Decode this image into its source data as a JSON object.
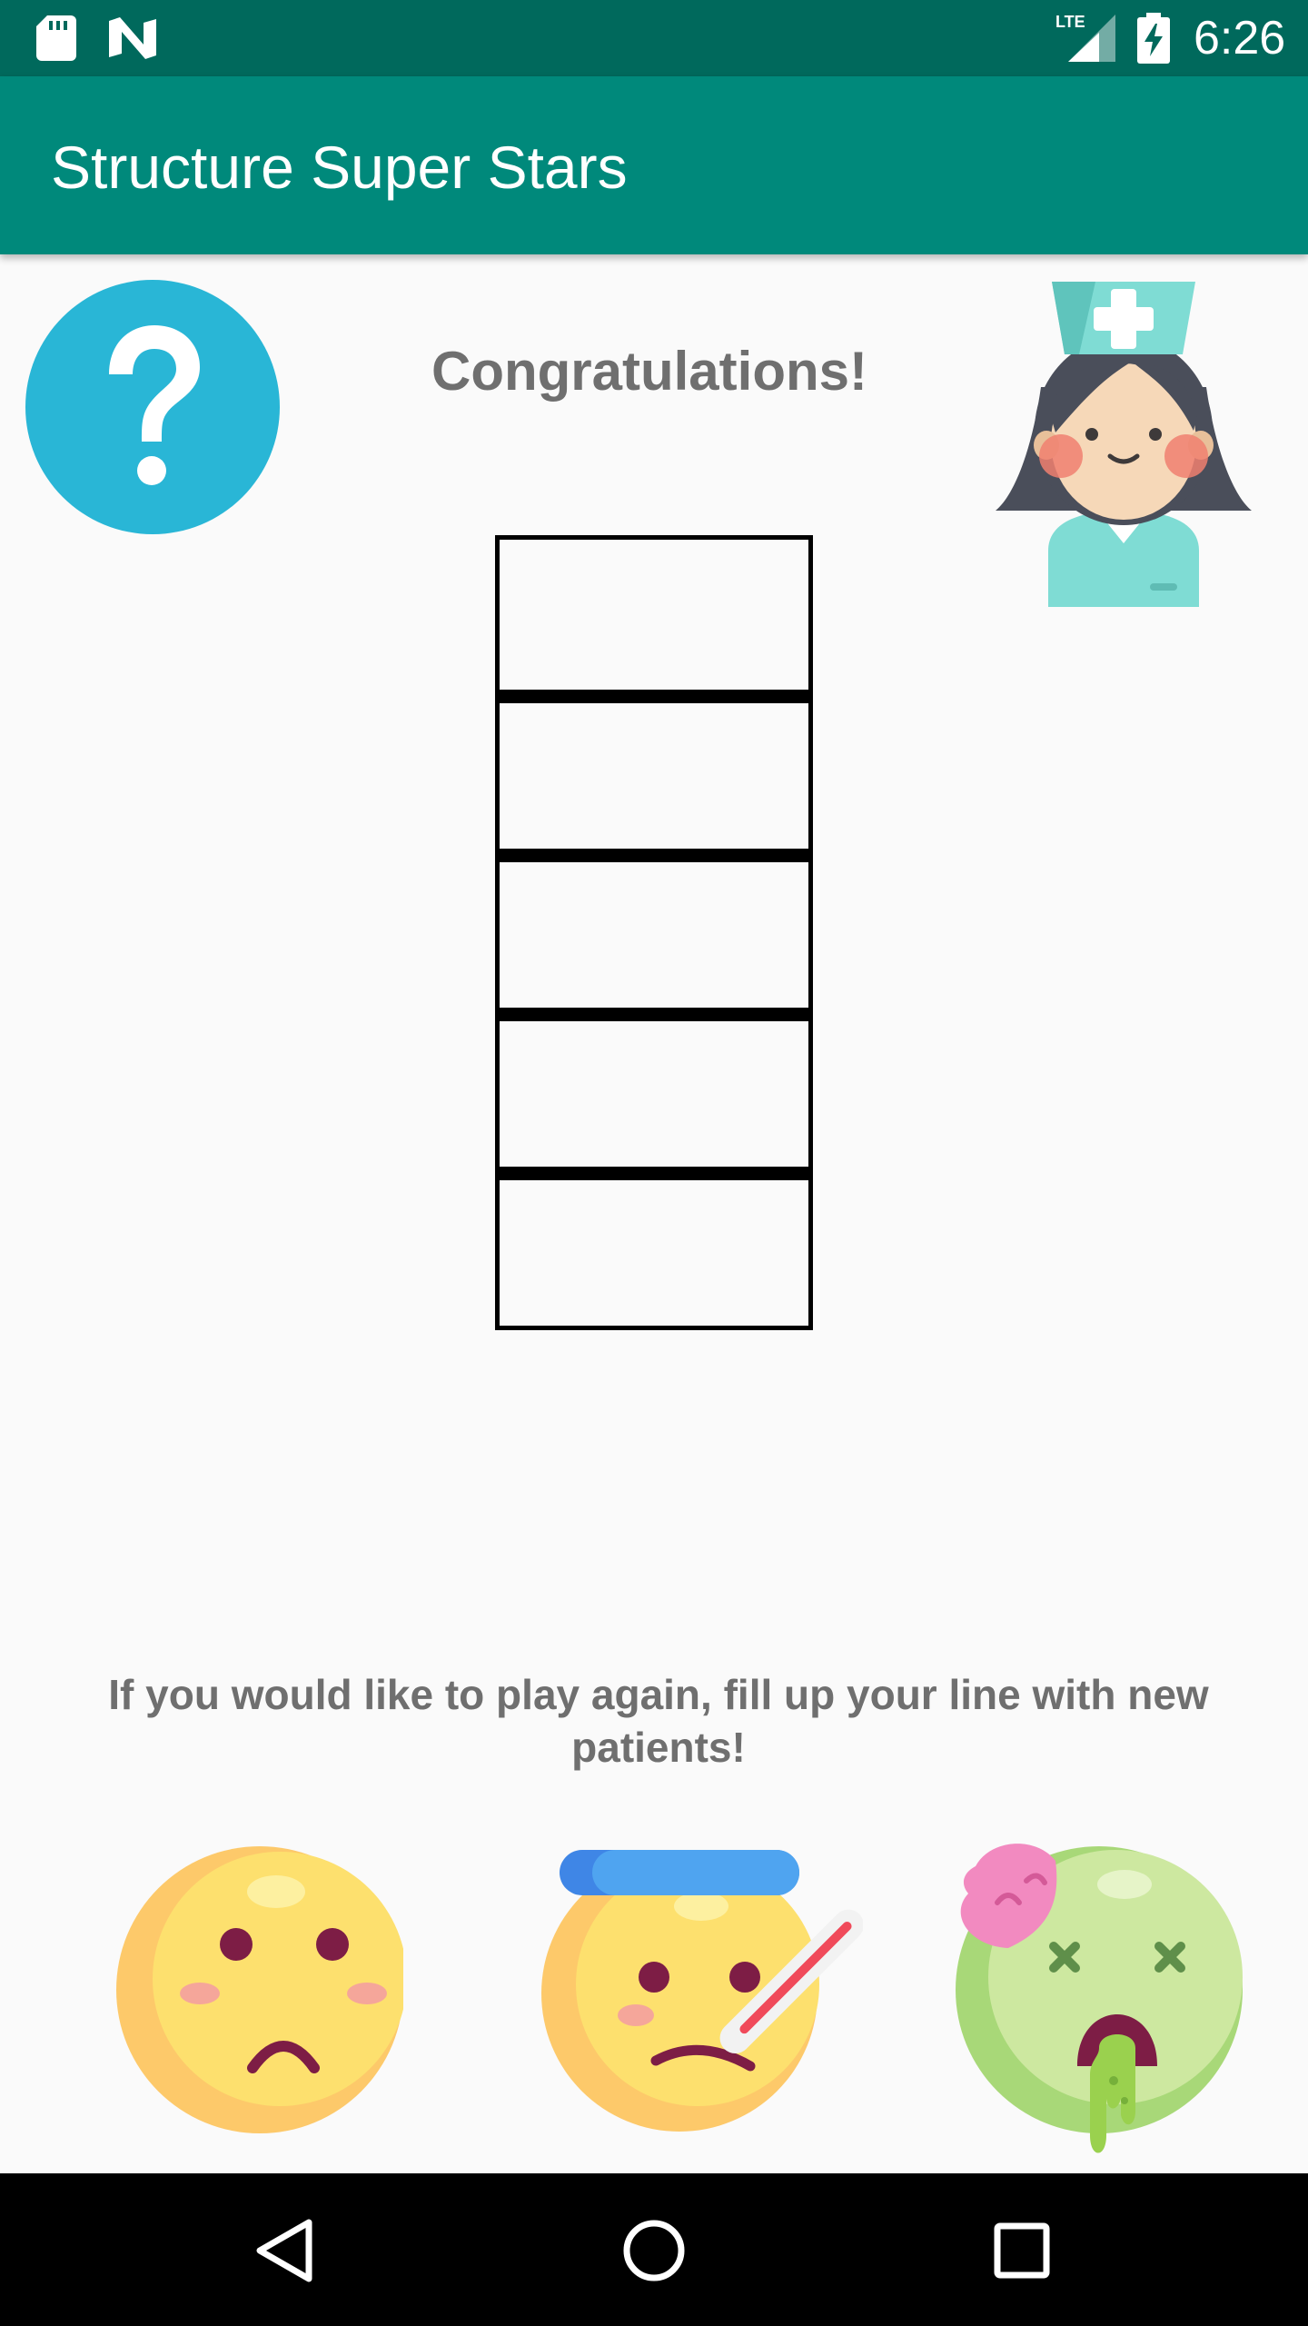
{
  "status_bar": {
    "time": "6:26",
    "network": "LTE",
    "icons": [
      "sd-card-icon",
      "n-notification-icon",
      "lte-signal-icon",
      "battery-charging-icon"
    ]
  },
  "app_bar": {
    "title": "Structure Super Stars"
  },
  "main": {
    "heading": "Congratulations!",
    "help_icon": "question-mark-icon",
    "nurse_icon": "nurse-icon",
    "slots_count": 5,
    "instructions": "If you would like to play again, fill up your line with new patients!",
    "patients": [
      {
        "icon": "sad-face-icon"
      },
      {
        "icon": "fever-face-icon"
      },
      {
        "icon": "zombie-face-icon"
      }
    ]
  },
  "nav_bar": {
    "buttons": [
      "back-icon",
      "home-icon",
      "recents-icon"
    ]
  },
  "colors": {
    "status_bar": "#00695c",
    "app_bar": "#00897b",
    "help_circle": "#29b6d6",
    "text_gray": "#6f6f6f",
    "background": "#fafafa"
  }
}
